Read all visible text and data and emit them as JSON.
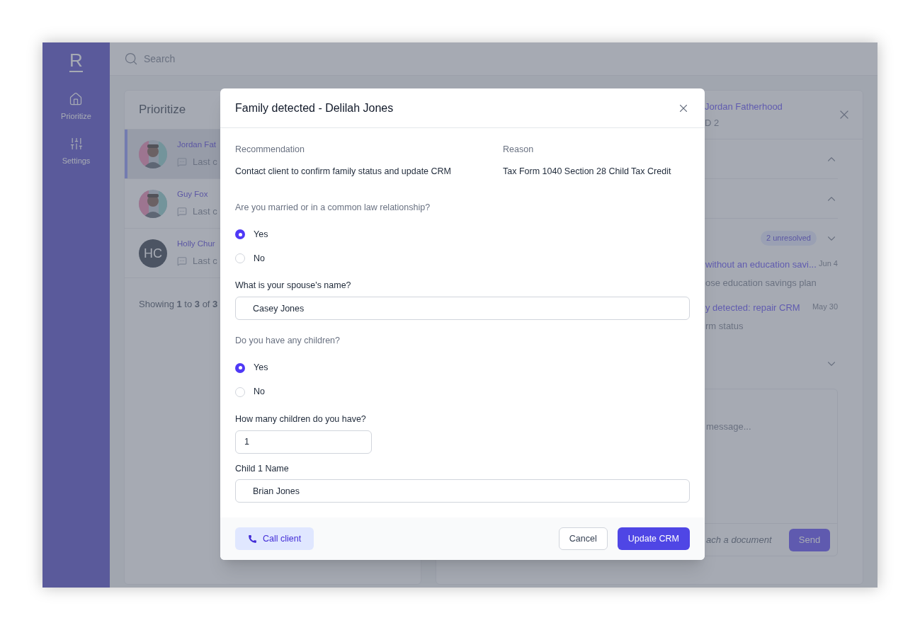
{
  "sidebar": {
    "logo": "R",
    "items": [
      {
        "label": "Prioritize",
        "kind": "home"
      },
      {
        "label": "Settings",
        "kind": "sliders"
      }
    ]
  },
  "search": {
    "placeholder": "Search"
  },
  "prioritize": {
    "title": "Prioritize",
    "clients": [
      {
        "name": "Jordan Fat",
        "last": "Last c",
        "kind": "picture",
        "selected": true
      },
      {
        "name": "Guy Fox",
        "last": "Last c",
        "kind": "picture",
        "selected": false
      },
      {
        "name": "Holly Chur",
        "last": "Last c",
        "kind": "initials",
        "initials": "HC",
        "selected": false
      }
    ],
    "footer": "Showing **1** to **3** of **3**"
  },
  "detail": {
    "title": "Jordan Fatherhood",
    "subtitle": "D 2",
    "sections": [
      {
        "expanded": true
      },
      {
        "expanded": true
      },
      {
        "expanded": false,
        "badge": "2 unresolved",
        "items": [
          {
            "title": "without an education savi...",
            "subtitle": "ose education savings plan",
            "date": "Jun 4"
          },
          {
            "title": "y detected: repair CRM",
            "subtitle": "rm status",
            "date": "May 30"
          }
        ]
      },
      {
        "expanded": false
      }
    ],
    "composer": {
      "placeholder": "message...",
      "attach": "ach a document",
      "send": "Send"
    }
  },
  "modal": {
    "title": "Family detected - Delilah Jones",
    "recommendation": {
      "label": "Recommendation",
      "value": "Contact client to confirm family status and update CRM"
    },
    "reason": {
      "label": "Reason",
      "value": "Tax Form 1040 Section 28 Child Tax Credit"
    },
    "questions": [
      {
        "kind": "radio",
        "label": "Are you married or in a common law relationship?",
        "options": [
          {
            "label": "Yes",
            "selected": true
          },
          {
            "label": "No",
            "selected": false
          }
        ]
      },
      {
        "kind": "text",
        "label": "What is your spouse's name?",
        "value": "Casey Jones"
      },
      {
        "kind": "radio",
        "label": "Do you have any children?",
        "options": [
          {
            "label": "Yes",
            "selected": true
          },
          {
            "label": "No",
            "selected": false
          }
        ]
      },
      {
        "kind": "number",
        "label": "How many children do you have?",
        "value": "1"
      },
      {
        "kind": "text",
        "label": "Child 1 Name",
        "value": "Brian Jones"
      }
    ],
    "call": "Call client",
    "cancel": "Cancel",
    "update": "Update CRM"
  }
}
